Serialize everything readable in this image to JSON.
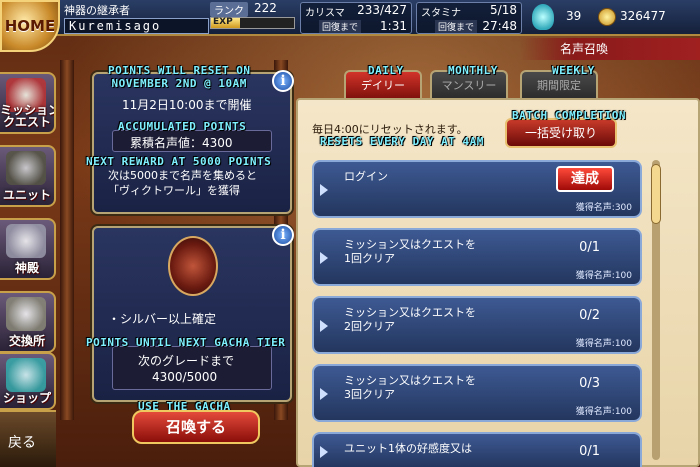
{
  "header": {
    "home_label": "HOME",
    "player_title": "神器の継承者",
    "player_name": "Kuremisago",
    "rank_label": "ランク",
    "rank_value": "222",
    "exp_label": "EXP",
    "exp_fraction": 0.35,
    "charisma_label": "カリスマ",
    "charisma_value": "233/427",
    "charisma_recover_label": "回復まで",
    "charisma_recover_time": "1:31",
    "stamina_label": "スタミナ",
    "stamina_value": "5/18",
    "stamina_recover_label": "回復まで",
    "stamina_recover_time": "27:48",
    "gems": "39",
    "gold": "326477",
    "page_title": "名声召喚"
  },
  "nav": {
    "items": [
      {
        "label": "ミッション\nクエスト",
        "icon": "wings-sword-icon"
      },
      {
        "label": "ユニット",
        "icon": "knight-icon"
      },
      {
        "label": "神殿",
        "icon": "goddess-icon"
      },
      {
        "label": "交換所",
        "icon": "scales-icon"
      },
      {
        "label": "ショップ",
        "icon": "crystal-icon"
      }
    ],
    "back_label": "戻る"
  },
  "top_panel": {
    "trans_reset": "POINTS WILL RESET ON\nNOVEMBER 2ND @ 10AM",
    "held_until": "11月2日10:00まで開催",
    "trans_accum": "ACCUMULATED POINTS",
    "accum_label": "累積名声値：4300",
    "trans_next": "NEXT REWARD AT 5000 POINTS",
    "next_reward": "次は5000まで名声を集めると\n「ヴィクトワール」を獲得"
  },
  "gacha_panel": {
    "guarantee": "・シルバー以上確定",
    "trans_tier": "POINTS UNTIL NEXT GACHA TIER",
    "next_grade_label": "次のグレードまで",
    "next_grade_value": "4300/5000",
    "trans_use": "USE THE GACHA",
    "summon_button": "召喚する"
  },
  "tabs": [
    {
      "label": "デイリー",
      "trans": "DAILY",
      "active": true
    },
    {
      "label": "マンスリー",
      "trans": "MONTHLY",
      "active": false
    },
    {
      "label": "期間限定",
      "trans": "WEEKLY",
      "active": false
    }
  ],
  "missions_panel": {
    "reset_note": "毎日4:00にリセットされます。",
    "trans_reset": "RESETS EVERY DAY AT 4AM",
    "batch_button": "一括受け取り",
    "trans_batch": "BATCH COMPLETION",
    "missions": [
      {
        "title": "ログイン",
        "progress": "",
        "done_label": "達成",
        "reward": "獲得名声:300"
      },
      {
        "title": "ミッション又はクエストを\n1回クリア",
        "progress": "0/1",
        "reward": "獲得名声:100"
      },
      {
        "title": "ミッション又はクエストを\n2回クリア",
        "progress": "0/2",
        "reward": "獲得名声:100"
      },
      {
        "title": "ミッション又はクエストを\n3回クリア",
        "progress": "0/3",
        "reward": "獲得名声:100"
      },
      {
        "title": "ユニット1体の好感度又は",
        "progress": "0/1",
        "reward": ""
      }
    ]
  }
}
